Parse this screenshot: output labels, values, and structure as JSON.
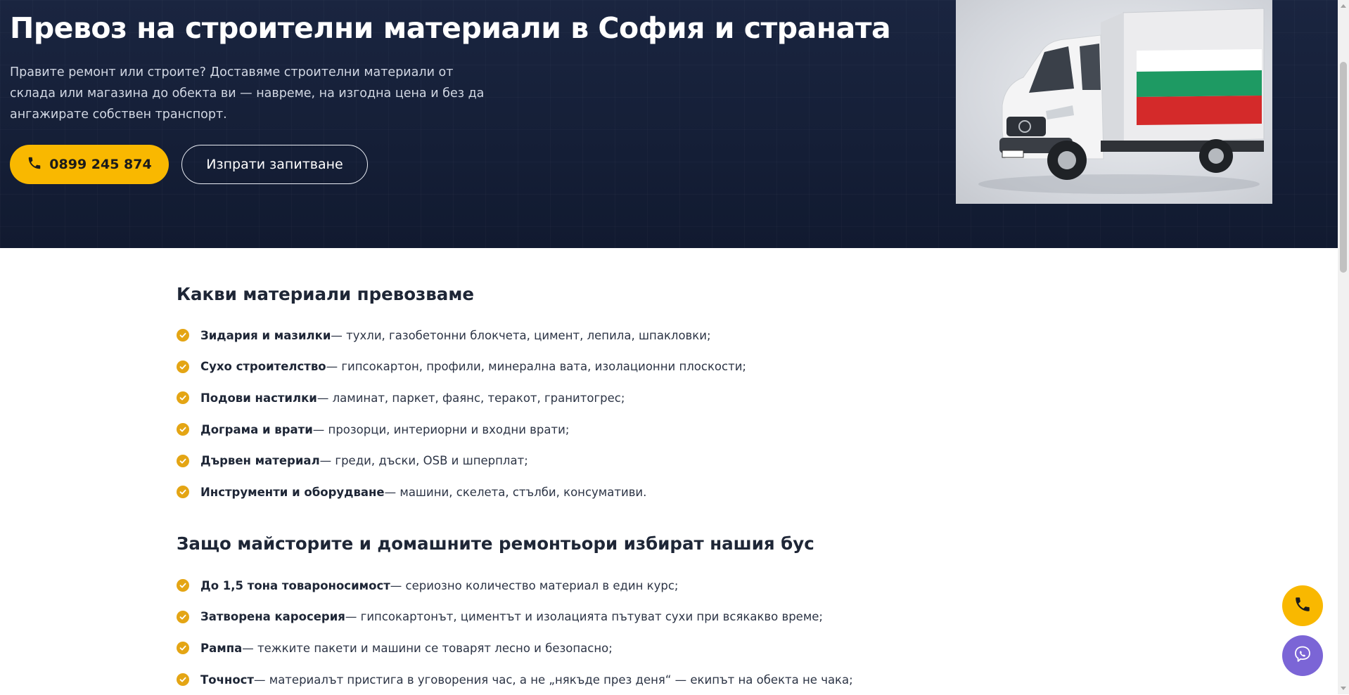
{
  "hero": {
    "title": "Превоз на строителни материали в София и страната",
    "subtitle": "Правите ремонт или строите? Доставяме строителни материали от склада или магазина до обекта ви — навреме, на изгодна цена и без да ангажирате собствен транспорт.",
    "phone_button_label": "0899 245 874",
    "inquiry_button_label": "Изпрати запитване",
    "image_alt": "Бус с каросерия в цветовете на българското знаме"
  },
  "sections": [
    {
      "heading": "Какви материали превозваме",
      "items": [
        {
          "title": "Зидария и мазилки",
          "desc": " — тухли, газобетонни блокчета, цимент, лепила, шпакловки;"
        },
        {
          "title": "Сухо строителство",
          "desc": " — гипсокартон, профили, минерална вата, изолационни плоскости;"
        },
        {
          "title": "Подови настилки",
          "desc": " — ламинат, паркет, фаянс, теракот, гранитогрес;"
        },
        {
          "title": "Дограма и врати",
          "desc": " — прозорци, интериорни и входни врати;"
        },
        {
          "title": "Дървен материал",
          "desc": " — греди, дъски, OSB и шперплат;"
        },
        {
          "title": "Инструменти и оборудване",
          "desc": " — машини, скелета, стълби, консумативи."
        }
      ]
    },
    {
      "heading": "Защо майсторите и домашните ремонтьори избират нашия бус",
      "items": [
        {
          "title": "До 1,5 тона товароносимост",
          "desc": " — сериозно количество материал в един курс;"
        },
        {
          "title": "Затворена каросерия",
          "desc": " — гипсокартонът, циментът и изолацията пътуват сухи при всякакво време;"
        },
        {
          "title": "Рампа",
          "desc": " — тежките пакети и машини се товарят лесно и безопасно;"
        },
        {
          "title": "Точност",
          "desc": " — материалът пристига в уговорения час, а не „някъде през деня“ — екипът на обекта не чака;"
        }
      ]
    }
  ],
  "colors": {
    "accent": "#f9b800",
    "hero_bg": "#141d35",
    "check": "#e4a514",
    "viber": "#7b65d6"
  },
  "icons": {
    "phone": "phone-icon",
    "check": "check-circle-icon",
    "viber": "viber-icon"
  }
}
